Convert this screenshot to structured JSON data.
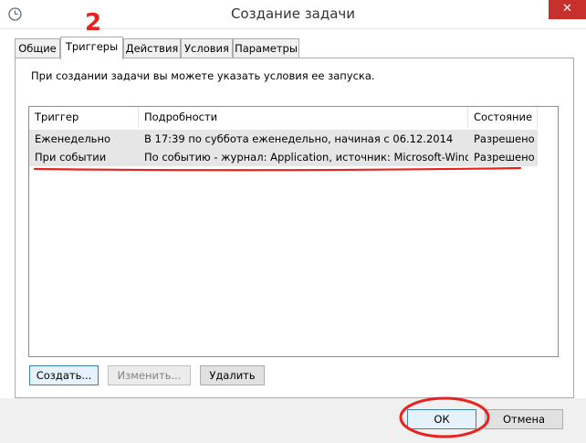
{
  "window": {
    "title": "Создание задачи",
    "close_glyph": "✕",
    "icon": "clock-app-icon"
  },
  "tabs": [
    {
      "label": "Общие",
      "active": false
    },
    {
      "label": "Триггеры",
      "active": true
    },
    {
      "label": "Действия",
      "active": false
    },
    {
      "label": "Условия",
      "active": false
    },
    {
      "label": "Параметры",
      "active": false
    }
  ],
  "description": "При создании задачи вы можете указать условия ее запуска.",
  "table": {
    "columns": [
      "Триггер",
      "Подробности",
      "Состояние"
    ],
    "rows": [
      {
        "trigger": "Еженедельно",
        "details": "В 17:39 по суббота еженедельно, начиная с 06.12.2014",
        "state": "Разрешено"
      },
      {
        "trigger": "При событии",
        "details": "По событию - журнал: Application, источник: Microsoft-Wind...",
        "state": "Разрешено"
      }
    ]
  },
  "buttons": {
    "create": "Создать...",
    "edit": "Изменить...",
    "delete": "Удалить",
    "ok": "ОК",
    "cancel": "Отмена"
  },
  "annotation": {
    "step_number": "2",
    "color": "#e8231f"
  }
}
